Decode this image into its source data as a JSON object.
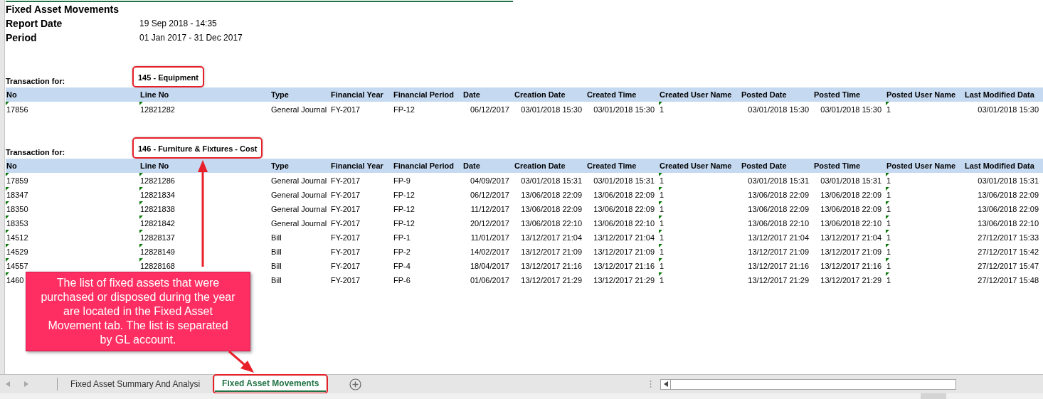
{
  "report": {
    "title": "Fixed Asset Movements",
    "fields": [
      {
        "label": "Report Date",
        "value": "19 Sep 2018 - 14:35"
      },
      {
        "label": "Period",
        "value": "01 Jan 2017 - 31 Dec 2017"
      }
    ]
  },
  "sections": [
    {
      "caption": "Transaction for:",
      "account": "145 - Equipment",
      "highlighted": true,
      "columns": [
        {
          "label": "No",
          "flagged": true
        },
        {
          "label": "Line No",
          "flagged": true
        },
        {
          "label": "Type",
          "flagged": false
        },
        {
          "label": "Financial Year",
          "flagged": false
        },
        {
          "label": "Financial Period",
          "flagged": false
        },
        {
          "label": "Date",
          "flagged": false
        },
        {
          "label": "Creation Date",
          "flagged": false
        },
        {
          "label": "Created Time",
          "flagged": false
        },
        {
          "label": "Created User Name",
          "flagged": true
        },
        {
          "label": "Posted Date",
          "flagged": false
        },
        {
          "label": "Posted Time",
          "flagged": false
        },
        {
          "label": "Posted User Name",
          "flagged": true
        },
        {
          "label": "Last Modified Data",
          "flagged": false
        }
      ],
      "rows": [
        [
          "17856",
          "12821282",
          "General Journal",
          "FY-2017",
          "FP-12",
          "06/12/2017",
          "03/01/2018 15:30",
          "03/01/2018 15:30",
          "1",
          "03/01/2018 15:30",
          "03/01/2018 15:30",
          "1",
          "03/01/2018 15:30"
        ]
      ]
    },
    {
      "caption": "Transaction for:",
      "account": "146 - Furniture & Fixtures - Cost",
      "highlighted": true,
      "columns": [
        {
          "label": "No",
          "flagged": true
        },
        {
          "label": "Line No",
          "flagged": true
        },
        {
          "label": "Type",
          "flagged": false
        },
        {
          "label": "Financial Year",
          "flagged": false
        },
        {
          "label": "Financial Period",
          "flagged": false
        },
        {
          "label": "Date",
          "flagged": false
        },
        {
          "label": "Creation Date",
          "flagged": false
        },
        {
          "label": "Created Time",
          "flagged": false
        },
        {
          "label": "Created User Name",
          "flagged": true
        },
        {
          "label": "Posted Date",
          "flagged": false
        },
        {
          "label": "Posted Time",
          "flagged": false
        },
        {
          "label": "Posted User Name",
          "flagged": true
        },
        {
          "label": "Last Modified Data",
          "flagged": false
        }
      ],
      "rows": [
        [
          "17859",
          "12821286",
          "General Journal",
          "FY-2017",
          "FP-9",
          "04/09/2017",
          "03/01/2018 15:31",
          "03/01/2018 15:31",
          "1",
          "03/01/2018 15:31",
          "03/01/2018 15:31",
          "1",
          "03/01/2018 15:31"
        ],
        [
          "18347",
          "12821834",
          "General Journal",
          "FY-2017",
          "FP-12",
          "06/12/2017",
          "13/06/2018 22:09",
          "13/06/2018 22:09",
          "1",
          "13/06/2018 22:09",
          "13/06/2018 22:09",
          "1",
          "13/06/2018 22:09"
        ],
        [
          "18350",
          "12821838",
          "General Journal",
          "FY-2017",
          "FP-12",
          "11/12/2017",
          "13/06/2018 22:09",
          "13/06/2018 22:09",
          "1",
          "13/06/2018 22:09",
          "13/06/2018 22:09",
          "1",
          "13/06/2018 22:09"
        ],
        [
          "18353",
          "12821842",
          "General Journal",
          "FY-2017",
          "FP-12",
          "20/12/2017",
          "13/06/2018 22:10",
          "13/06/2018 22:10",
          "1",
          "13/06/2018 22:10",
          "13/06/2018 22:10",
          "1",
          "13/06/2018 22:10"
        ],
        [
          "14512",
          "12828137",
          "Bill",
          "FY-2017",
          "FP-1",
          "11/01/2017",
          "13/12/2017 21:04",
          "13/12/2017 21:04",
          "1",
          "13/12/2017 21:04",
          "13/12/2017 21:04",
          "1",
          "27/12/2017 15:33"
        ],
        [
          "14529",
          "12828149",
          "Bill",
          "FY-2017",
          "FP-2",
          "14/02/2017",
          "13/12/2017 21:09",
          "13/12/2017 21:09",
          "1",
          "13/12/2017 21:09",
          "13/12/2017 21:09",
          "1",
          "27/12/2017 15:42"
        ],
        [
          "14557",
          "12828168",
          "Bill",
          "FY-2017",
          "FP-4",
          "18/04/2017",
          "13/12/2017 21:16",
          "13/12/2017 21:16",
          "1",
          "13/12/2017 21:16",
          "13/12/2017 21:16",
          "1",
          "27/12/2017 15:47"
        ],
        [
          "1460",
          null,
          "Bill",
          "FY-2017",
          "FP-6",
          "01/06/2017",
          "13/12/2017 21:29",
          "13/12/2017 21:29",
          "1",
          "13/12/2017 21:29",
          "13/12/2017 21:29",
          "1",
          "27/12/2017 15:48"
        ]
      ]
    }
  ],
  "callout": {
    "text": "The list of fixed assets that were purchased or disposed during the year are located in the Fixed Asset Movement tab. The list is separated by GL account."
  },
  "sheet_tabs": [
    {
      "label": "Fixed Asset Summary And Analysi",
      "selected": false,
      "highlighted": false
    },
    {
      "label": "Fixed Asset Movements",
      "selected": true,
      "highlighted": true
    }
  ]
}
